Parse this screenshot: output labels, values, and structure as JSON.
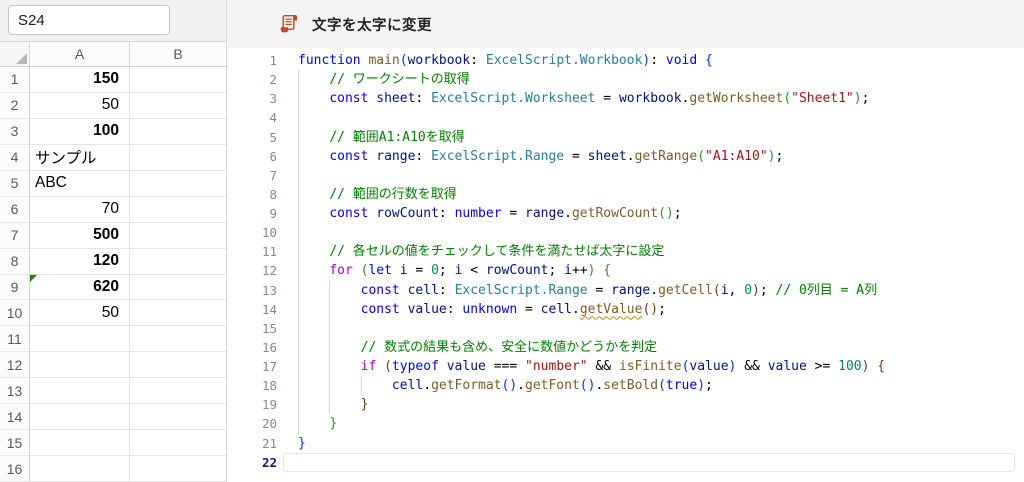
{
  "spreadsheet": {
    "name_box": "S24",
    "column_headers": [
      "A",
      "B"
    ],
    "rows": [
      {
        "num": "1",
        "a": "150",
        "bold": true,
        "align": "right",
        "error_flag": false
      },
      {
        "num": "2",
        "a": "50",
        "bold": false,
        "align": "right",
        "error_flag": false
      },
      {
        "num": "3",
        "a": "100",
        "bold": true,
        "align": "right",
        "error_flag": false
      },
      {
        "num": "4",
        "a": "サンプル",
        "bold": false,
        "align": "left",
        "error_flag": false
      },
      {
        "num": "5",
        "a": "ABC",
        "bold": false,
        "align": "left",
        "error_flag": false
      },
      {
        "num": "6",
        "a": "70",
        "bold": false,
        "align": "right",
        "error_flag": false
      },
      {
        "num": "7",
        "a": "500",
        "bold": true,
        "align": "right",
        "error_flag": false
      },
      {
        "num": "8",
        "a": "120",
        "bold": true,
        "align": "right",
        "error_flag": false
      },
      {
        "num": "9",
        "a": "620",
        "bold": true,
        "align": "right",
        "error_flag": true
      },
      {
        "num": "10",
        "a": "50",
        "bold": false,
        "align": "right",
        "error_flag": false
      },
      {
        "num": "11",
        "a": "",
        "bold": false,
        "align": "right",
        "error_flag": false
      },
      {
        "num": "12",
        "a": "",
        "bold": false,
        "align": "right",
        "error_flag": false
      },
      {
        "num": "13",
        "a": "",
        "bold": false,
        "align": "right",
        "error_flag": false
      },
      {
        "num": "14",
        "a": "",
        "bold": false,
        "align": "right",
        "error_flag": false
      },
      {
        "num": "15",
        "a": "",
        "bold": false,
        "align": "right",
        "error_flag": false
      },
      {
        "num": "16",
        "a": "",
        "bold": false,
        "align": "right",
        "error_flag": false
      }
    ]
  },
  "editor": {
    "title": "文字を太字に変更",
    "icon": "office-script-icon",
    "lines": [
      {
        "n": "1",
        "guides": 0,
        "active": false,
        "tokens": [
          [
            "kw",
            "function"
          ],
          [
            "pl",
            " "
          ],
          [
            "fn",
            "main"
          ],
          [
            "b1",
            "("
          ],
          [
            "var",
            "workbook"
          ],
          [
            "pl",
            ": "
          ],
          [
            "type",
            "ExcelScript.Workbook"
          ],
          [
            "b1",
            ")"
          ],
          [
            "pl",
            ": "
          ],
          [
            "kw",
            "void"
          ],
          [
            "pl",
            " "
          ],
          [
            "b1",
            "{"
          ]
        ]
      },
      {
        "n": "2",
        "guides": 1,
        "active": false,
        "tokens": [
          [
            "pl",
            "    "
          ],
          [
            "com",
            "// ワークシートの取得"
          ]
        ]
      },
      {
        "n": "3",
        "guides": 1,
        "active": false,
        "tokens": [
          [
            "pl",
            "    "
          ],
          [
            "kw",
            "const"
          ],
          [
            "pl",
            " "
          ],
          [
            "var",
            "sheet"
          ],
          [
            "pl",
            ": "
          ],
          [
            "type",
            "ExcelScript.Worksheet"
          ],
          [
            "pl",
            " = "
          ],
          [
            "var",
            "workbook"
          ],
          [
            "pl",
            "."
          ],
          [
            "fn",
            "getWorksheet"
          ],
          [
            "b2",
            "("
          ],
          [
            "str",
            "\"Sheet1\""
          ],
          [
            "b2",
            ")"
          ],
          [
            "pl",
            ";"
          ]
        ]
      },
      {
        "n": "4",
        "guides": 1,
        "active": false,
        "tokens": []
      },
      {
        "n": "5",
        "guides": 1,
        "active": false,
        "tokens": [
          [
            "pl",
            "    "
          ],
          [
            "com",
            "// 範囲A1:A10を取得"
          ]
        ]
      },
      {
        "n": "6",
        "guides": 1,
        "active": false,
        "tokens": [
          [
            "pl",
            "    "
          ],
          [
            "kw",
            "const"
          ],
          [
            "pl",
            " "
          ],
          [
            "var",
            "range"
          ],
          [
            "pl",
            ": "
          ],
          [
            "type",
            "ExcelScript.Range"
          ],
          [
            "pl",
            " = "
          ],
          [
            "var",
            "sheet"
          ],
          [
            "pl",
            "."
          ],
          [
            "fn",
            "getRange"
          ],
          [
            "b2",
            "("
          ],
          [
            "str",
            "\"A1:A10\""
          ],
          [
            "b2",
            ")"
          ],
          [
            "pl",
            ";"
          ]
        ]
      },
      {
        "n": "7",
        "guides": 1,
        "active": false,
        "tokens": []
      },
      {
        "n": "8",
        "guides": 1,
        "active": false,
        "tokens": [
          [
            "pl",
            "    "
          ],
          [
            "com",
            "// 範囲の行数を取得"
          ]
        ]
      },
      {
        "n": "9",
        "guides": 1,
        "active": false,
        "tokens": [
          [
            "pl",
            "    "
          ],
          [
            "kw",
            "const"
          ],
          [
            "pl",
            " "
          ],
          [
            "var",
            "rowCount"
          ],
          [
            "pl",
            ": "
          ],
          [
            "kw",
            "number"
          ],
          [
            "pl",
            " = "
          ],
          [
            "var",
            "range"
          ],
          [
            "pl",
            "."
          ],
          [
            "fn",
            "getRowCount"
          ],
          [
            "b2",
            "()"
          ],
          [
            "pl",
            ";"
          ]
        ]
      },
      {
        "n": "10",
        "guides": 1,
        "active": false,
        "tokens": []
      },
      {
        "n": "11",
        "guides": 1,
        "active": false,
        "tokens": [
          [
            "pl",
            "    "
          ],
          [
            "com",
            "// 各セルの値をチェックして条件を満たせば太字に設定"
          ]
        ]
      },
      {
        "n": "12",
        "guides": 1,
        "active": false,
        "tokens": [
          [
            "pl",
            "    "
          ],
          [
            "ctrl",
            "for"
          ],
          [
            "pl",
            " "
          ],
          [
            "b2",
            "("
          ],
          [
            "kw",
            "let"
          ],
          [
            "pl",
            " "
          ],
          [
            "var",
            "i"
          ],
          [
            "pl",
            " = "
          ],
          [
            "num",
            "0"
          ],
          [
            "pl",
            "; "
          ],
          [
            "var",
            "i"
          ],
          [
            "pl",
            " < "
          ],
          [
            "var",
            "rowCount"
          ],
          [
            "pl",
            "; "
          ],
          [
            "var",
            "i"
          ],
          [
            "pl",
            "++"
          ],
          [
            "b2",
            ")"
          ],
          [
            "pl",
            " "
          ],
          [
            "b2",
            "{"
          ]
        ]
      },
      {
        "n": "13",
        "guides": 2,
        "active": false,
        "tokens": [
          [
            "pl",
            "        "
          ],
          [
            "kw",
            "const"
          ],
          [
            "pl",
            " "
          ],
          [
            "var",
            "cell"
          ],
          [
            "pl",
            ": "
          ],
          [
            "type",
            "ExcelScript.Range"
          ],
          [
            "pl",
            " = "
          ],
          [
            "var",
            "range"
          ],
          [
            "pl",
            "."
          ],
          [
            "fn",
            "getCell"
          ],
          [
            "b3",
            "("
          ],
          [
            "var",
            "i"
          ],
          [
            "pl",
            ", "
          ],
          [
            "num",
            "0"
          ],
          [
            "b3",
            ")"
          ],
          [
            "pl",
            "; "
          ],
          [
            "com",
            "// 0列目 = A列"
          ]
        ]
      },
      {
        "n": "14",
        "guides": 2,
        "active": false,
        "tokens": [
          [
            "pl",
            "        "
          ],
          [
            "kw",
            "const"
          ],
          [
            "pl",
            " "
          ],
          [
            "var",
            "value"
          ],
          [
            "pl",
            ": "
          ],
          [
            "kw",
            "unknown"
          ],
          [
            "pl",
            " = "
          ],
          [
            "var",
            "cell"
          ],
          [
            "pl",
            "."
          ],
          [
            "fnw",
            "getValue"
          ],
          [
            "b3",
            "()"
          ],
          [
            "pl",
            ";"
          ]
        ]
      },
      {
        "n": "15",
        "guides": 2,
        "active": false,
        "tokens": []
      },
      {
        "n": "16",
        "guides": 2,
        "active": false,
        "tokens": [
          [
            "pl",
            "        "
          ],
          [
            "com",
            "// 数式の結果も含め、安全に数値かどうかを判定"
          ]
        ]
      },
      {
        "n": "17",
        "guides": 2,
        "active": false,
        "tokens": [
          [
            "pl",
            "        "
          ],
          [
            "ctrl",
            "if"
          ],
          [
            "pl",
            " "
          ],
          [
            "b3",
            "("
          ],
          [
            "kw",
            "typeof"
          ],
          [
            "pl",
            " "
          ],
          [
            "var",
            "value"
          ],
          [
            "pl",
            " === "
          ],
          [
            "str",
            "\"number\""
          ],
          [
            "pl",
            " && "
          ],
          [
            "fn",
            "isFinite"
          ],
          [
            "b1",
            "("
          ],
          [
            "var",
            "value"
          ],
          [
            "b1",
            ")"
          ],
          [
            "pl",
            " && "
          ],
          [
            "var",
            "value"
          ],
          [
            "pl",
            " >= "
          ],
          [
            "num",
            "100"
          ],
          [
            "b3",
            ")"
          ],
          [
            "pl",
            " "
          ],
          [
            "b3",
            "{"
          ]
        ]
      },
      {
        "n": "18",
        "guides": 3,
        "active": false,
        "tokens": [
          [
            "pl",
            "            "
          ],
          [
            "var",
            "cell"
          ],
          [
            "pl",
            "."
          ],
          [
            "fn",
            "getFormat"
          ],
          [
            "b1",
            "()"
          ],
          [
            "pl",
            "."
          ],
          [
            "fn",
            "getFont"
          ],
          [
            "b1",
            "()"
          ],
          [
            "pl",
            "."
          ],
          [
            "fn",
            "setBold"
          ],
          [
            "b1",
            "("
          ],
          [
            "kw",
            "true"
          ],
          [
            "b1",
            ")"
          ],
          [
            "pl",
            ";"
          ]
        ]
      },
      {
        "n": "19",
        "guides": 2,
        "active": false,
        "tokens": [
          [
            "pl",
            "        "
          ],
          [
            "b3",
            "}"
          ]
        ]
      },
      {
        "n": "20",
        "guides": 1,
        "active": false,
        "tokens": [
          [
            "pl",
            "    "
          ],
          [
            "b2",
            "}"
          ]
        ]
      },
      {
        "n": "21",
        "guides": 0,
        "active": false,
        "tokens": [
          [
            "b1",
            "}"
          ]
        ]
      },
      {
        "n": "22",
        "guides": 0,
        "active": true,
        "tokens": []
      }
    ]
  },
  "colors": {
    "icon_accent": "#c4452c",
    "error_flag_green": "#15890f",
    "keyword": "#0000ff",
    "control": "#af00db",
    "type": "#267f99",
    "function": "#795e26",
    "variable": "#001080",
    "string": "#a31515",
    "number": "#098658",
    "comment": "#008000",
    "bracket_depth1": "#0431fa",
    "bracket_depth2": "#319331",
    "bracket_depth3": "#7b3814",
    "warning_squiggle": "#bf8803",
    "line_number": "#7b8ba3",
    "line_number_active": "#0b216f"
  }
}
